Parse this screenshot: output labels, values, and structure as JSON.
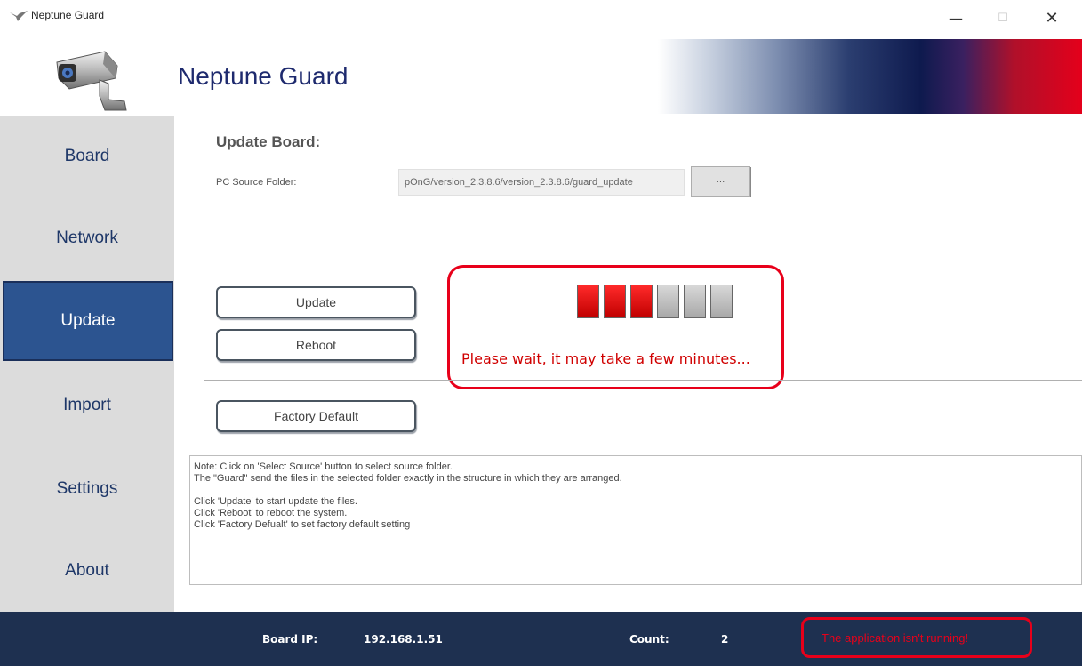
{
  "window": {
    "title": "Neptune Guard",
    "minimize_glyph": "—",
    "maximize_glyph": "☐",
    "close_glyph": "✕"
  },
  "header": {
    "app_title": "Neptune Guard",
    "logo_icon": "security-camera-icon"
  },
  "sidebar": {
    "items": [
      {
        "label": "Board"
      },
      {
        "label": "Network"
      },
      {
        "label": "Update",
        "active": true
      },
      {
        "label": "Import"
      },
      {
        "label": "Settings"
      },
      {
        "label": "About"
      }
    ]
  },
  "main": {
    "section_title": "Update Board:",
    "source_label": "PC Source Folder:",
    "source_value": "pOnG/version_2.3.8.6/version_2.3.8.6/guard_update",
    "browse_label": "...",
    "update_label": "Update",
    "reboot_label": "Reboot",
    "factory_label": "Factory Default",
    "progress": {
      "filled": 3,
      "total": 6,
      "message": "Please wait, it may take a few minutes..."
    },
    "notes": [
      "Note: Click on 'Select Source' button to select source folder.",
      "The \"Guard\" send the files in the selected folder exactly in the structure in which they are arranged.",
      "",
      "Click 'Update' to start update the files.",
      "Click 'Reboot' to reboot the system.",
      "Click 'Factory Defualt' to set factory default setting"
    ]
  },
  "status": {
    "board_ip_label": "Board IP:",
    "board_ip_value": "192.168.1.51",
    "count_label": "Count:",
    "count_value": "2",
    "warning": "The application isn't running!"
  },
  "colors": {
    "accent_blue": "#2c5490",
    "alert_red": "#e8001a",
    "statusbar_bg": "#1e3050"
  }
}
